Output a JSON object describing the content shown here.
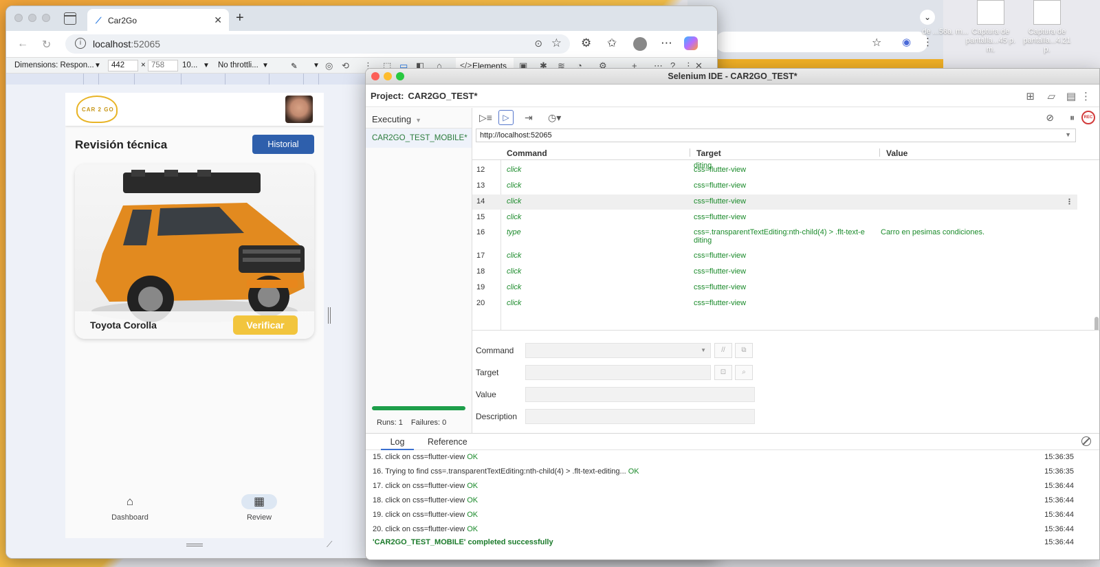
{
  "desktop": {
    "files": [
      {
        "label": "de ...56a. m..."
      },
      {
        "label": "Captura de pantalla...45 p. m."
      },
      {
        "label": "Captura de pantalla...4.21 p."
      }
    ]
  },
  "browser": {
    "tab_title": "Car2Go",
    "url_host": "localhost",
    "url_port": ":52065",
    "devtools": {
      "dimensions_label": "Dimensions: Respon...",
      "width": "442",
      "height": "758",
      "zoom": "10...",
      "throttling": "No throttli...",
      "elements_tab": "Elements"
    }
  },
  "app": {
    "logo_text": "CAR 2 GO",
    "page_title": "Revisión técnica",
    "history_button": "Historial",
    "car_name": "Toyota Corolla",
    "verify_button": "Verificar",
    "nav": [
      {
        "label": "Dashboard",
        "icon": "home-icon"
      },
      {
        "label": "Review",
        "icon": "grid-icon"
      }
    ]
  },
  "ide": {
    "window_title": "Selenium IDE - CAR2GO_TEST*",
    "project_label": "Project:",
    "project_name": "CAR2GO_TEST*",
    "executing_label": "Executing",
    "suite_name": "CAR2GO_TEST_MOBILE*",
    "runs": "Runs: 1",
    "failures": "Failures: 0",
    "base_url": "http://localhost:52065",
    "columns": {
      "command": "Command",
      "target": "Target",
      "value": "Value"
    },
    "partial_row_target": "diting",
    "rows": [
      {
        "num": "12",
        "command": "click",
        "target": "css=flutter-view",
        "value": ""
      },
      {
        "num": "13",
        "command": "click",
        "target": "css=flutter-view",
        "value": ""
      },
      {
        "num": "14",
        "command": "click",
        "target": "css=flutter-view",
        "value": "",
        "selected": true
      },
      {
        "num": "15",
        "command": "click",
        "target": "css=flutter-view",
        "value": ""
      },
      {
        "num": "16",
        "command": "type",
        "target": "css=.transparentTextEditing:nth-child(4) > .flt-text-e diting",
        "value": "Carro en pesimas condiciones."
      },
      {
        "num": "17",
        "command": "click",
        "target": "css=flutter-view",
        "value": ""
      },
      {
        "num": "18",
        "command": "click",
        "target": "css=flutter-view",
        "value": ""
      },
      {
        "num": "19",
        "command": "click",
        "target": "css=flutter-view",
        "value": ""
      },
      {
        "num": "20",
        "command": "click",
        "target": "css=flutter-view",
        "value": ""
      }
    ],
    "editor": {
      "command_label": "Command",
      "target_label": "Target",
      "value_label": "Value",
      "description_label": "Description"
    },
    "log_tabs": {
      "log": "Log",
      "reference": "Reference"
    },
    "log": [
      {
        "text": "15.  click on css=flutter-view ",
        "status": "OK",
        "time": "15:36:35"
      },
      {
        "text": "16.  Trying to find css=.transparentTextEditing:nth-child(4) > .flt-text-editing... ",
        "status": "OK",
        "time": "15:36:35"
      },
      {
        "text": "17.  click on css=flutter-view ",
        "status": "OK",
        "time": "15:36:44"
      },
      {
        "text": "18.  click on css=flutter-view ",
        "status": "OK",
        "time": "15:36:44"
      },
      {
        "text": "19.  click on css=flutter-view ",
        "status": "OK",
        "time": "15:36:44"
      },
      {
        "text": "20.  click on css=flutter-view ",
        "status": "OK",
        "time": "15:36:44"
      }
    ],
    "completed_message": "'CAR2GO_TEST_MOBILE' completed successfully",
    "completed_time": "15:36:44"
  }
}
